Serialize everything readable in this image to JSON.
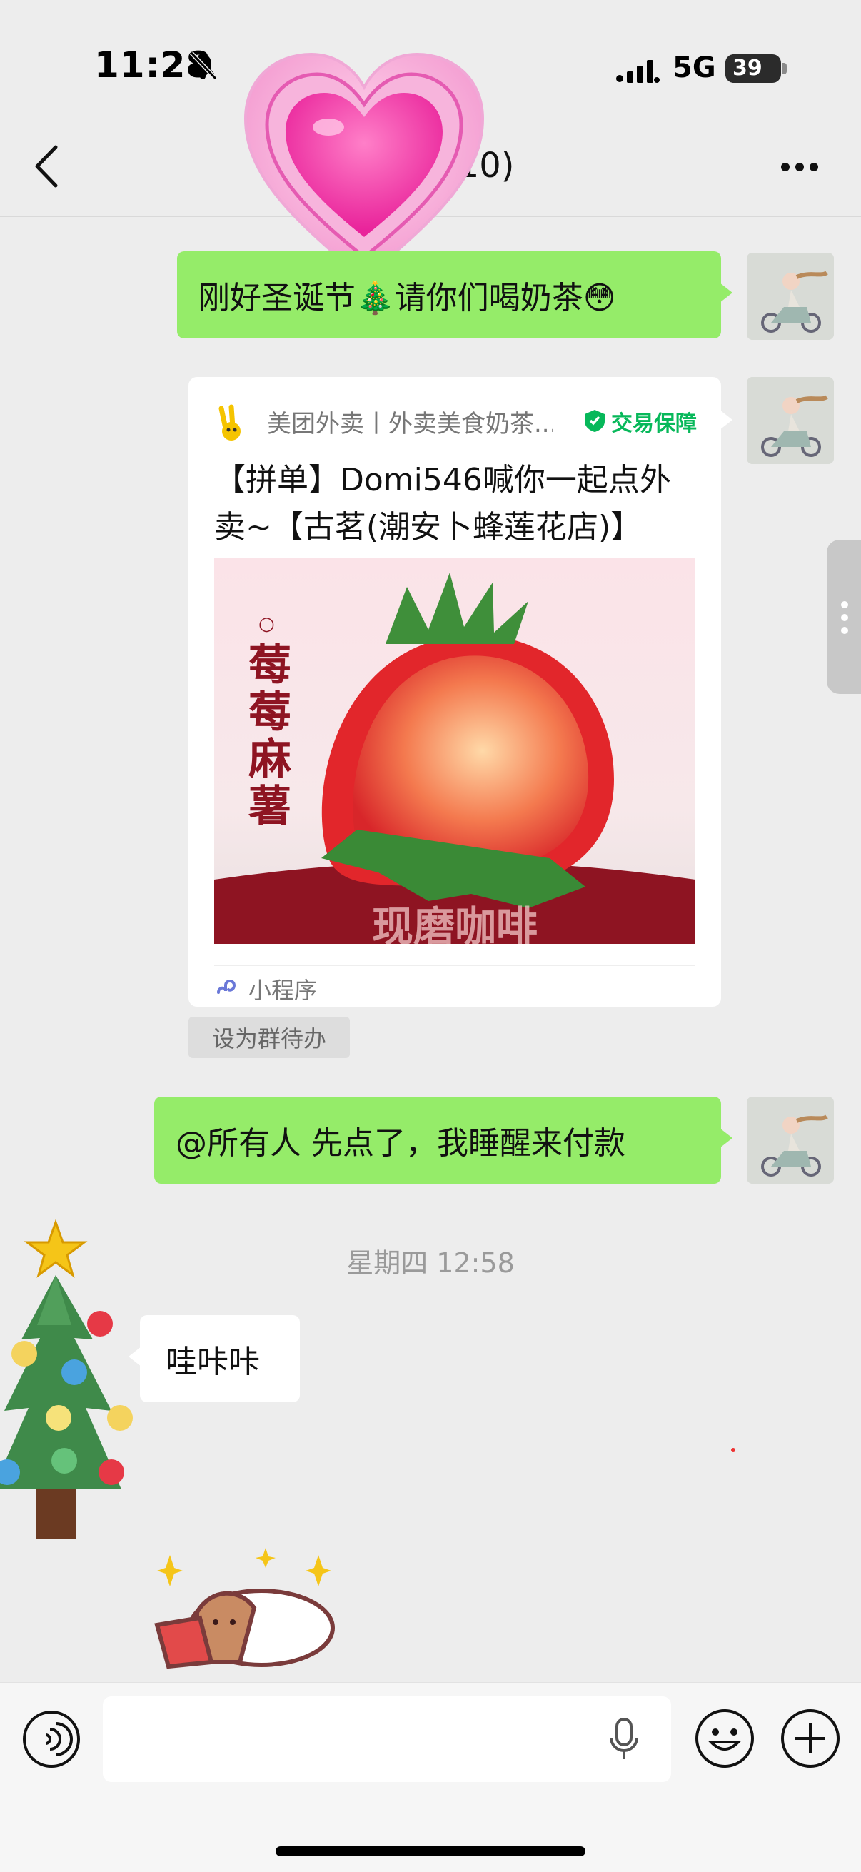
{
  "status_bar": {
    "time": "11:28",
    "network": "5G",
    "battery": 39,
    "battery_label": "39"
  },
  "header": {
    "title": "(10)",
    "back_icon": "chevron-left-icon",
    "more_icon": "more-dots-icon"
  },
  "messages": {
    "m1": {
      "text": "刚好圣诞节🎄请你们喝奶茶😳"
    },
    "card": {
      "app_name": "美团外卖丨外卖美食奶茶...",
      "guarantee": "交易保障",
      "title": "【拼单】Domi546喊你一起点外卖~【古茗(潮安卜蜂莲花店)】",
      "image_text": "莓莓麻薯",
      "image_bottom_text": "现磨咖啡",
      "type_label": "小程序"
    },
    "todo": "设为群待办",
    "m2": {
      "text": "@所有人 先点了，我睡醒来付款"
    },
    "timestamp": "星期四 12:58",
    "m3": {
      "text": "哇咔咔"
    }
  },
  "colors": {
    "green_bubble": "#95ec69",
    "background": "#ededed",
    "guarantee_green": "#07b85a"
  }
}
